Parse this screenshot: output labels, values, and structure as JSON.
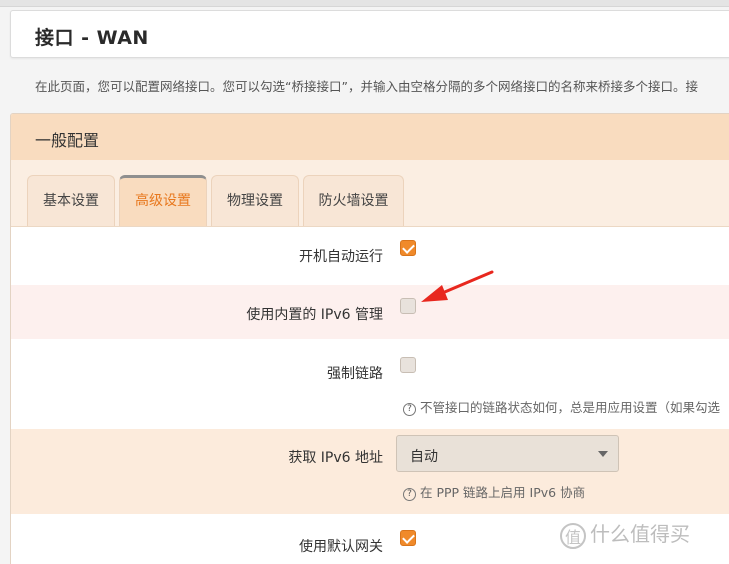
{
  "header": {
    "title": "接口 - WAN"
  },
  "description": "在此页面，您可以配置网络接口。您可以勾选“桥接接口”，并输入由空格分隔的多个网络接口的名称来桥接多个接口。接",
  "section": {
    "title": "一般配置"
  },
  "tabs": [
    {
      "label": "基本设置",
      "active": false
    },
    {
      "label": "高级设置",
      "active": true
    },
    {
      "label": "物理设置",
      "active": false
    },
    {
      "label": "防火墙设置",
      "active": false
    }
  ],
  "fields": {
    "autostart": {
      "label": "开机自动运行",
      "checked": true
    },
    "ipv6_manage": {
      "label": "使用内置的 IPv6 管理",
      "checked": false
    },
    "force_link": {
      "label": "强制链路",
      "checked": false,
      "hint": "不管接口的链路状态如何，总是用应用设置（如果勾选"
    },
    "ipv6_addr": {
      "label": "获取 IPv6 地址",
      "value": "自动",
      "hint": "在 PPP 链路上启用 IPv6 协商"
    },
    "default_gw": {
      "label": "使用默认网关",
      "checked": true
    }
  },
  "watermark": {
    "logo": "值",
    "text": "什么值得买"
  },
  "colors": {
    "accent": "#f08a2a",
    "section_header": "#f9dcbf",
    "arrow": "#e8271e"
  }
}
